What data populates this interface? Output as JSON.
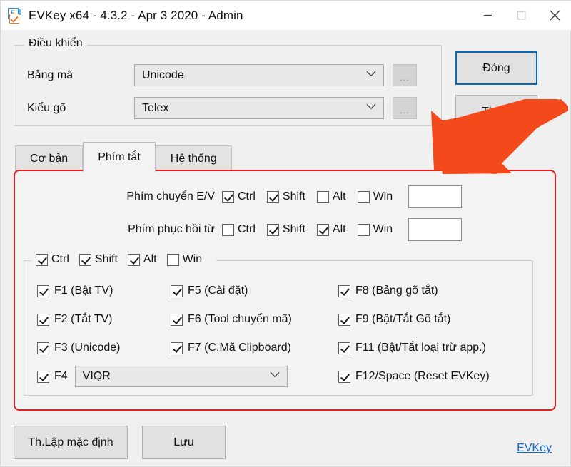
{
  "window": {
    "title": "EVKey x64 - 4.3.2 - Apr  3 2020 - Admin",
    "icon": "evkey-app-icon",
    "controls": {
      "minimize": "minimize-icon",
      "maximize": "maximize-icon",
      "close": "close-icon"
    }
  },
  "control_group": {
    "legend": "Điều khiển",
    "fields": [
      {
        "label": "Bảng mã",
        "value": "Unicode",
        "browse": "..."
      },
      {
        "label": "Kiểu gõ",
        "value": "Telex",
        "browse": "..."
      }
    ]
  },
  "actions": {
    "close_label": "Đóng",
    "exit_label": "Thoát"
  },
  "tabs": [
    {
      "label": "Cơ bản",
      "active": false
    },
    {
      "label": "Phím tắt",
      "active": true
    },
    {
      "label": "Hệ thống",
      "active": false
    }
  ],
  "shortcuts": {
    "rows": [
      {
        "label": "Phím chuyển E/V",
        "modifiers": [
          {
            "label": "Ctrl",
            "checked": true
          },
          {
            "label": "Shift",
            "checked": true
          },
          {
            "label": "Alt",
            "checked": false
          },
          {
            "label": "Win",
            "checked": false
          }
        ],
        "key_value": "",
        "key_placeholder": ""
      },
      {
        "label": "Phím phục hồi từ",
        "modifiers": [
          {
            "label": "Ctrl",
            "checked": false
          },
          {
            "label": "Shift",
            "checked": true
          },
          {
            "label": "Alt",
            "checked": true
          },
          {
            "label": "Win",
            "checked": false
          }
        ],
        "key_value": "",
        "key_placeholder": ""
      }
    ],
    "global_modifiers": [
      {
        "label": "Ctrl",
        "checked": true
      },
      {
        "label": "Shift",
        "checked": true
      },
      {
        "label": "Alt",
        "checked": true
      },
      {
        "label": "Win",
        "checked": false
      }
    ],
    "function_keys": {
      "column1": [
        {
          "label": "F1 (Bật TV)",
          "checked": true
        },
        {
          "label": "F2 (Tắt TV)",
          "checked": true
        },
        {
          "label": "F3 (Unicode)",
          "checked": true
        }
      ],
      "column2": [
        {
          "label": "F5 (Cài đặt)",
          "checked": true
        },
        {
          "label": "F6 (Tool chuyển mã)",
          "checked": true
        },
        {
          "label": "F7 (C.Mã Clipboard)",
          "checked": true
        }
      ],
      "column3": [
        {
          "label": "F8 (Bảng gõ tắt)",
          "checked": true
        },
        {
          "label": "F9 (Bật/Tắt Gõ tắt)",
          "checked": true
        },
        {
          "label": "F11 (Bật/Tắt loại trừ app.)",
          "checked": true
        },
        {
          "label": "F12/Space (Reset EVKey)",
          "checked": true
        }
      ],
      "f4": {
        "label": "F4",
        "checked": true,
        "value": "VIQR"
      }
    }
  },
  "footer": {
    "defaults_label": "Th.Lập mặc định",
    "save_label": "Lưu",
    "link_label": "EVKey"
  },
  "annotations": {
    "highlight_color": "#e32020",
    "arrow_color": "#f4491a",
    "accent_color": "#0a69b4",
    "link_color": "#1567c8"
  }
}
